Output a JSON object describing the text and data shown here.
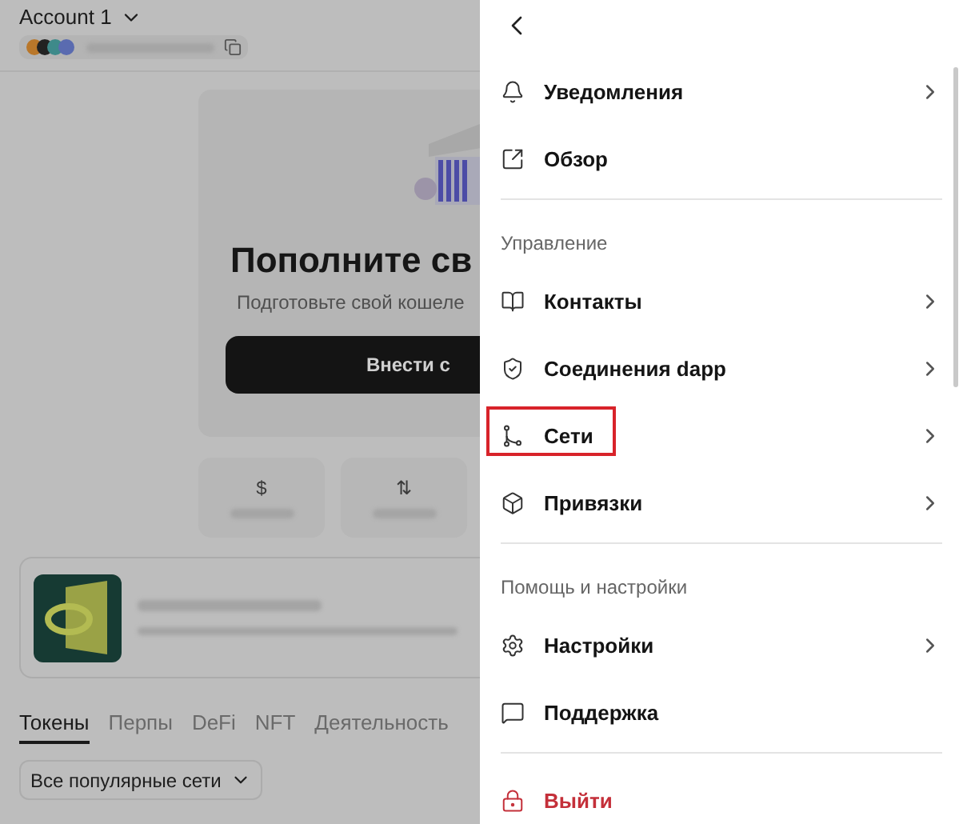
{
  "account": {
    "name": "Account 1"
  },
  "deposit_card": {
    "title": "Пополните св",
    "subtitle": "Подготовьте свой кошеле",
    "button": "Внести с"
  },
  "actions": [
    {
      "symbol": "$"
    },
    {
      "symbol": "⇅"
    }
  ],
  "asset_tabs": [
    {
      "label": "Токены",
      "selected": true
    },
    {
      "label": "Перпы",
      "selected": false
    },
    {
      "label": "DeFi",
      "selected": false
    },
    {
      "label": "NFT",
      "selected": false
    },
    {
      "label": "Деятельность",
      "selected": false
    }
  ],
  "network_filter": {
    "label": "Все популярные сети"
  },
  "menu": {
    "sections": [
      {
        "items": [
          {
            "label": "Уведомления",
            "kind": "normal",
            "chevron": true,
            "highlighted": false
          },
          {
            "label": "Обзор",
            "kind": "normal",
            "chevron": false,
            "highlighted": false
          }
        ]
      },
      {
        "title": "Управление",
        "items": [
          {
            "label": "Контакты",
            "kind": "normal",
            "chevron": true,
            "highlighted": false
          },
          {
            "label": "Соединения dapp",
            "kind": "normal",
            "chevron": true,
            "highlighted": false
          },
          {
            "label": "Сети",
            "kind": "normal",
            "chevron": true,
            "highlighted": true
          },
          {
            "label": "Привязки",
            "kind": "normal",
            "chevron": true,
            "highlighted": false
          }
        ]
      },
      {
        "title": "Помощь и настройки",
        "items": [
          {
            "label": "Настройки",
            "kind": "normal",
            "chevron": true,
            "highlighted": false
          },
          {
            "label": "Поддержка",
            "kind": "normal",
            "chevron": false,
            "highlighted": false
          }
        ]
      },
      {
        "items": [
          {
            "label": "Выйти",
            "kind": "logout",
            "chevron": false,
            "highlighted": false
          }
        ]
      }
    ]
  }
}
